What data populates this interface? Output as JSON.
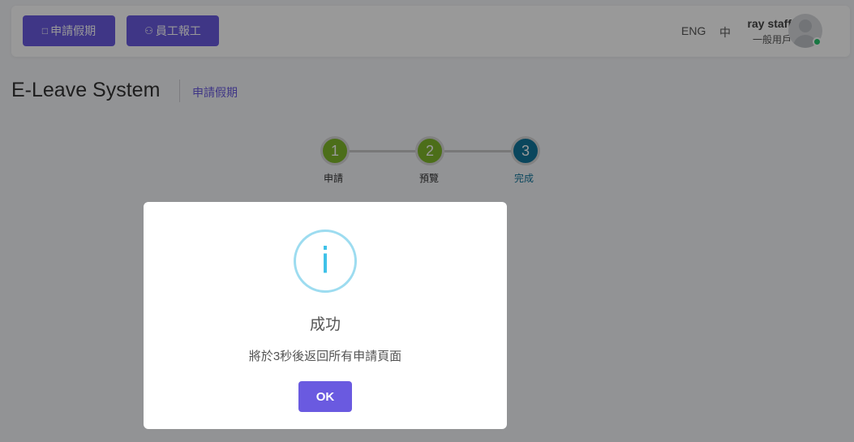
{
  "topbar": {
    "apply_leave_label": "申請假期",
    "staff_report_label": "員工報工",
    "lang_eng": "ENG",
    "lang_zh": "中",
    "user_name": "ray staff",
    "user_role": "一般用戶",
    "status_color": "#28c76f"
  },
  "page": {
    "title": "E-Leave System",
    "breadcrumb": "申請假期"
  },
  "stepper": {
    "steps": [
      {
        "number": "1",
        "label": "申請",
        "state": "done"
      },
      {
        "number": "2",
        "label": "預覽",
        "state": "done"
      },
      {
        "number": "3",
        "label": "完成",
        "state": "current"
      }
    ]
  },
  "modal": {
    "icon": "info-icon",
    "icon_glyph": "i",
    "title": "成功",
    "message": "將於3秒後返回所有申請頁面",
    "ok_label": "OK"
  },
  "colors": {
    "primary": "#6a5ae0",
    "step_done": "#7fb72b",
    "step_current": "#11759b",
    "info": "#3ec1e8"
  }
}
